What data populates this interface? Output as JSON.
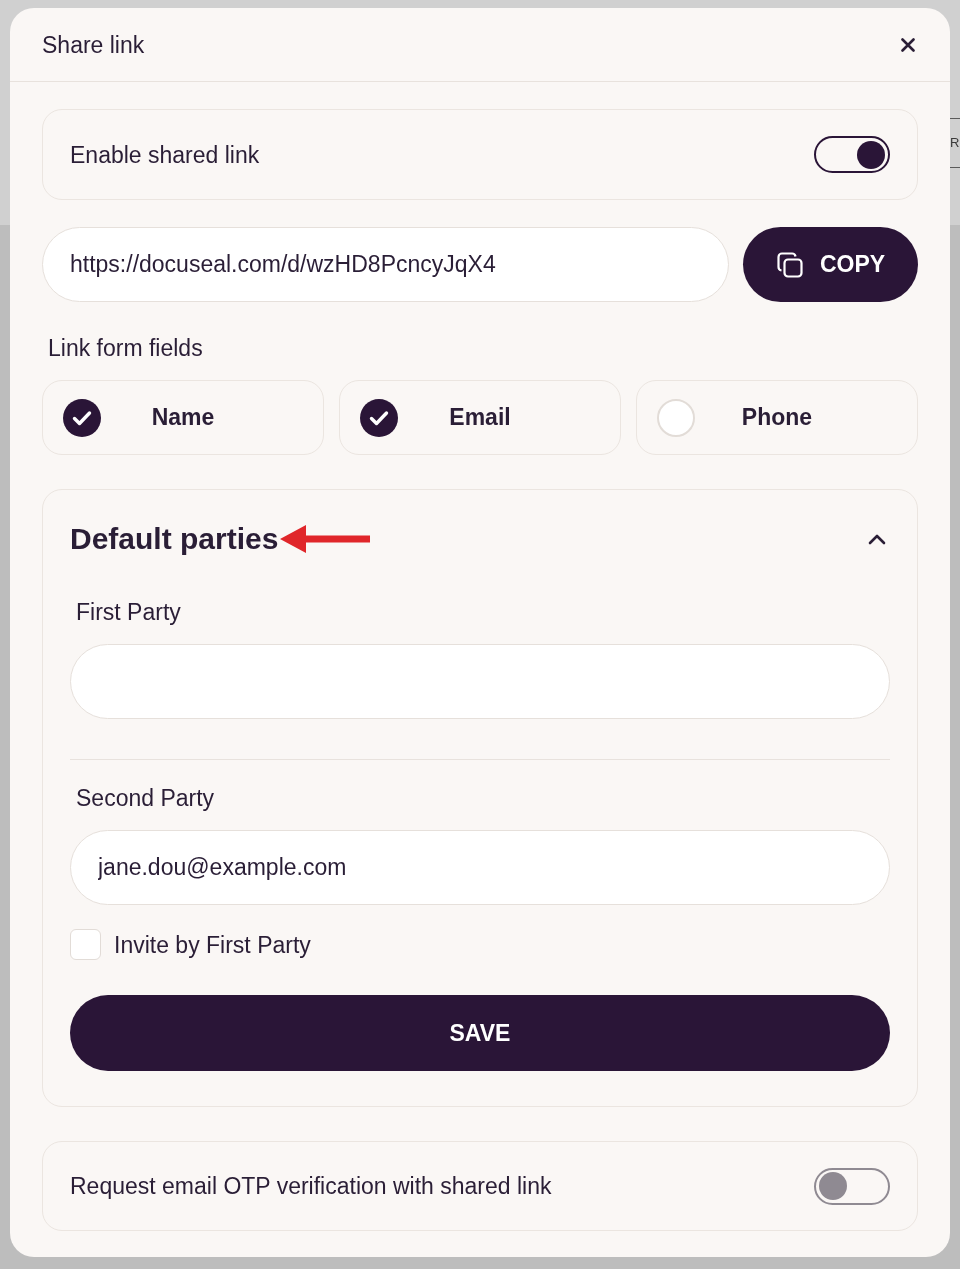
{
  "background_page": {
    "button_text": "R"
  },
  "dialog": {
    "title": "Share link"
  },
  "shared_link": {
    "label": "Enable shared link",
    "on": true
  },
  "link": {
    "value": "https://docuseal.com/d/wzHD8PcncyJqX4",
    "copy_button": "COPY"
  },
  "link_form_fields": {
    "title": "Link form fields",
    "options": [
      {
        "label": "Name",
        "checked": true
      },
      {
        "label": "Email",
        "checked": true
      },
      {
        "label": "Phone",
        "checked": false
      }
    ]
  },
  "default_parties": {
    "title": "Default parties",
    "expanded": true,
    "parties": [
      {
        "label": "First Party"
      },
      {
        "label": "Second Party",
        "value": "jane.dou@example.com"
      }
    ],
    "invite": {
      "label": "Invite by First Party",
      "checked": false
    },
    "save_button": "SAVE"
  },
  "otp": {
    "label": "Request email OTP verification with shared link",
    "on": false
  }
}
